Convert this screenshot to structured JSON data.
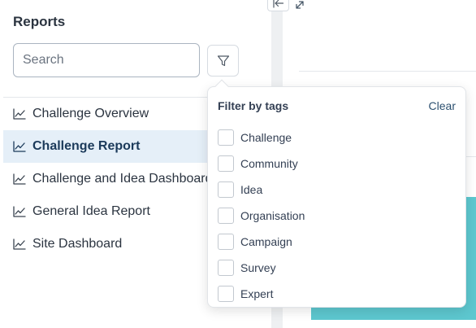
{
  "sidebar": {
    "title": "Reports",
    "search": {
      "placeholder": "Search",
      "value": ""
    },
    "reports": [
      {
        "label": "Challenge Overview",
        "active": false
      },
      {
        "label": "Challenge Report",
        "active": true
      },
      {
        "label": "Challenge and Idea Dashboard",
        "active": false
      },
      {
        "label": "General Idea Report",
        "active": false
      },
      {
        "label": "Site Dashboard",
        "active": false
      }
    ]
  },
  "filter_popover": {
    "title": "Filter by tags",
    "clear_label": "Clear",
    "tags": [
      "Challenge",
      "Community",
      "Idea",
      "Organisation",
      "Campaign",
      "Survey",
      "Expert"
    ]
  },
  "icons": {
    "filter": "filter-icon",
    "report": "line-chart-icon",
    "collapse": "arrow-left-to-line-icon",
    "expand": "expand-diagonal-icon"
  },
  "colors": {
    "active_item_bg": "#e5eff8",
    "active_item_text": "#1b3a5a",
    "accent_block": "#5dc7cf"
  }
}
